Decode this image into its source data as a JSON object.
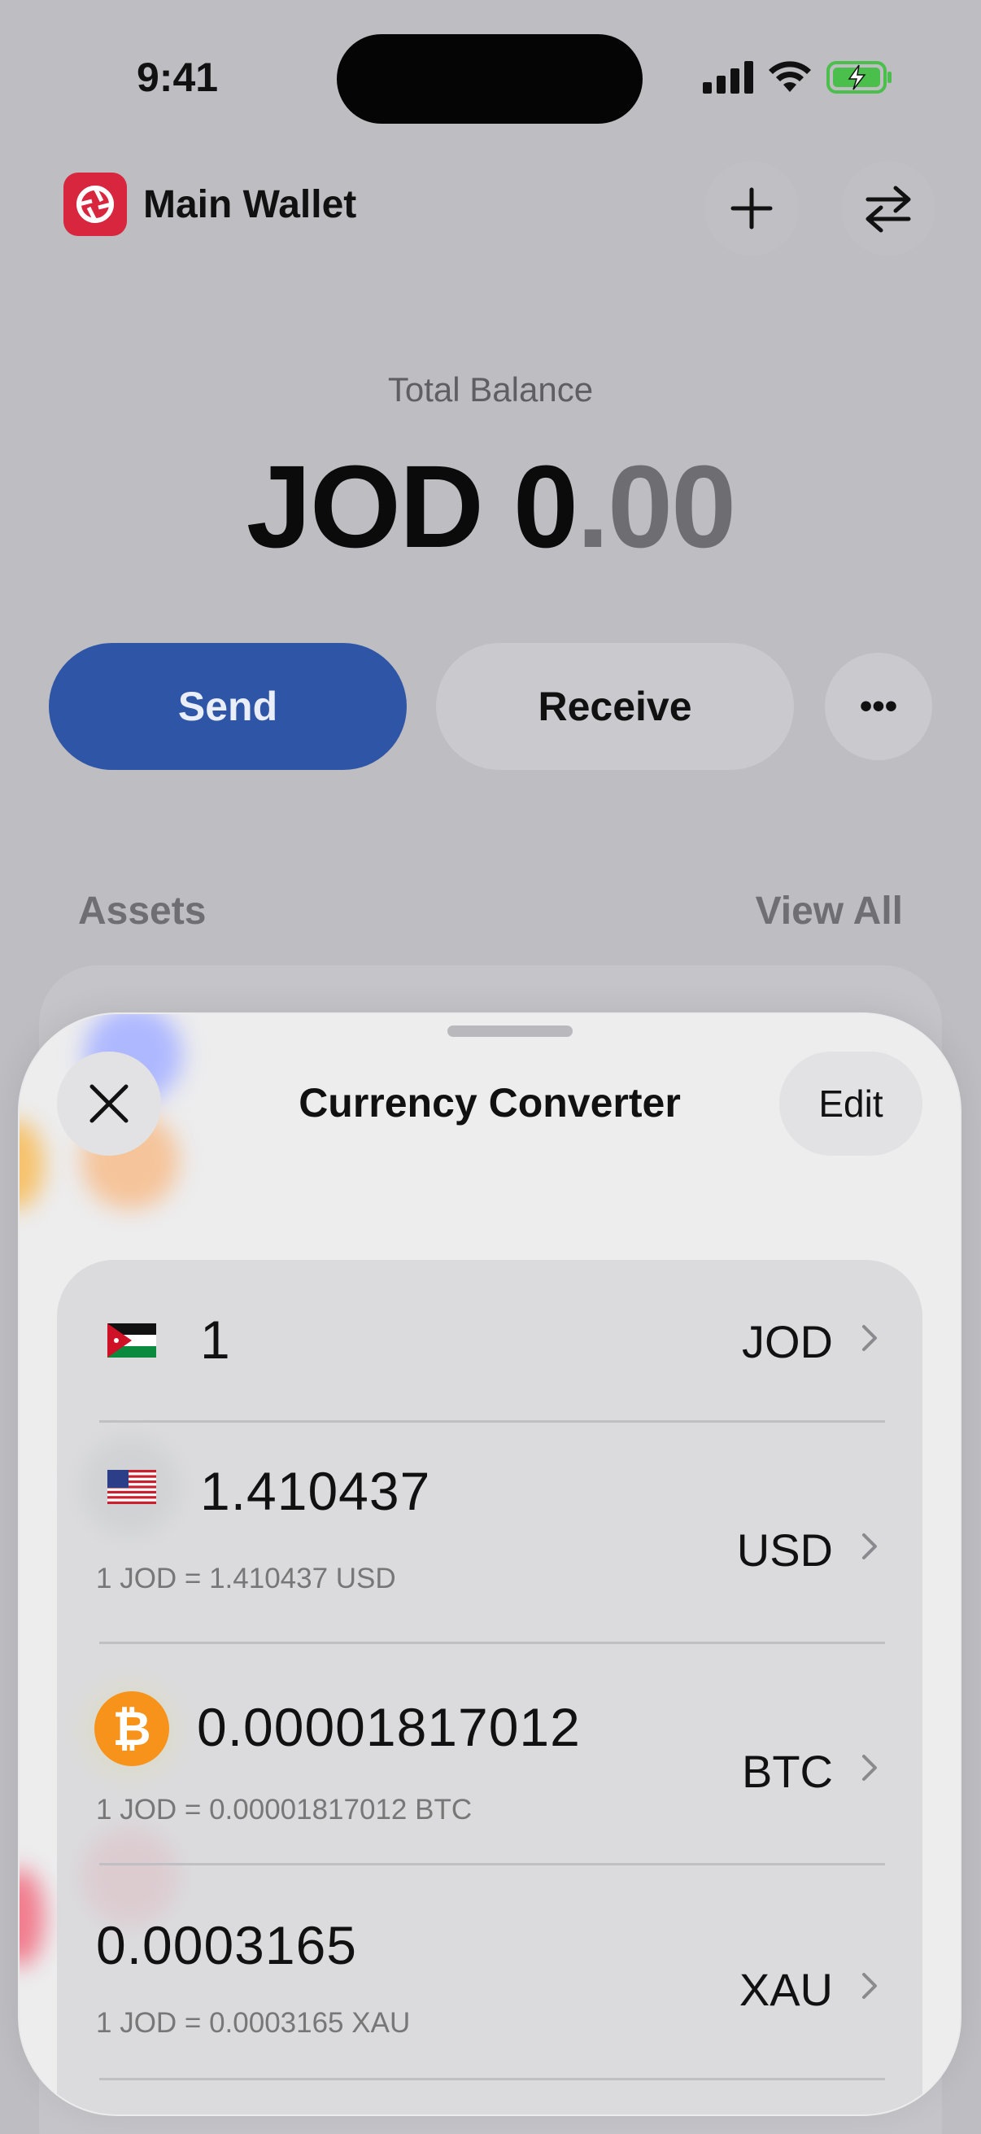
{
  "status_bar": {
    "time": "9:41"
  },
  "wallet": {
    "name": "Main Wallet",
    "balance_label": "Total Balance",
    "balance_integer": "JOD 0",
    "balance_decimal": ".00",
    "actions": {
      "send": "Send",
      "receive": "Receive",
      "more": "•••"
    },
    "assets_label": "Assets",
    "view_all": "View All"
  },
  "sheet": {
    "title": "Currency Converter",
    "edit_label": "Edit",
    "rows": [
      {
        "amount": "1",
        "code": "JOD",
        "rate": ""
      },
      {
        "amount": "1.410437",
        "code": "USD",
        "rate": "1 JOD = 1.410437 USD"
      },
      {
        "amount": "0.00001817012",
        "code": "BTC",
        "rate": "1 JOD = 0.00001817012 BTC"
      },
      {
        "amount": "0.0003165",
        "code": "XAU",
        "rate": "1 JOD = 0.0003165 XAU"
      }
    ]
  },
  "colors": {
    "accent": "#2f55a6",
    "brand": "#d7263d",
    "bitcoin": "#f7931a"
  },
  "icons": {
    "wallet_logo": "aperture-logo-icon",
    "add": "plus-icon",
    "swap": "swap-arrows-icon",
    "close": "close-icon",
    "chevron": "chevron-right-icon"
  }
}
